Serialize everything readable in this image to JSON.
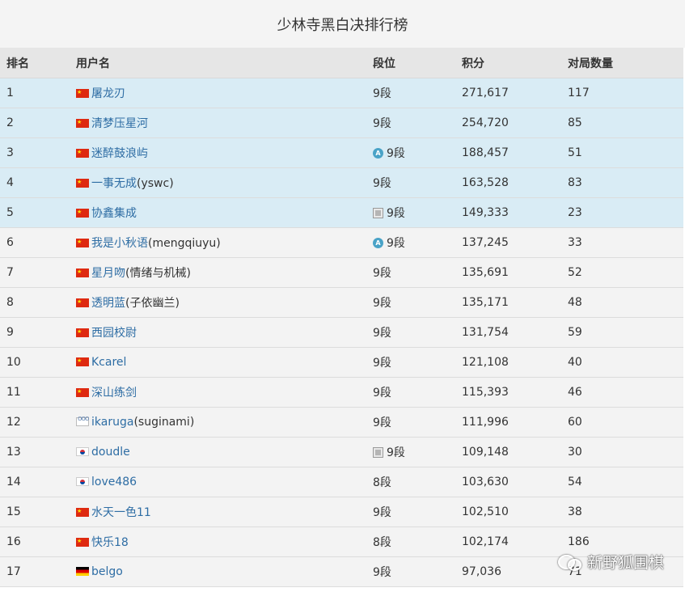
{
  "page_title": "少林寺黑白决排行榜",
  "headers": {
    "rank": "排名",
    "username": "用户名",
    "dan": "段位",
    "score": "积分",
    "games": "对局数量"
  },
  "rows": [
    {
      "rank": "1",
      "flag": "flag-cn",
      "name": "屠龙刃",
      "name_extra": "",
      "dan_icon": "",
      "dan": "9段",
      "score": "271,617",
      "games": "117",
      "highlight": true
    },
    {
      "rank": "2",
      "flag": "flag-cn",
      "name": "清梦压星河",
      "name_extra": "",
      "dan_icon": "",
      "dan": "9段",
      "score": "254,720",
      "games": "85",
      "highlight": true
    },
    {
      "rank": "3",
      "flag": "flag-cn",
      "name": "迷醉鼓浪屿",
      "name_extra": "",
      "dan_icon": "amateur-a-icon",
      "dan": "9段",
      "score": "188,457",
      "games": "51",
      "highlight": true
    },
    {
      "rank": "4",
      "flag": "flag-cn",
      "name": "一事无成",
      "name_extra": "(yswc)",
      "dan_icon": "",
      "dan": "9段",
      "score": "163,528",
      "games": "83",
      "highlight": true
    },
    {
      "rank": "5",
      "flag": "flag-cn",
      "name": "协鑫集成",
      "name_extra": "",
      "dan_icon": "pro-badge-icon",
      "dan": "9段",
      "score": "149,333",
      "games": "23",
      "highlight": true
    },
    {
      "rank": "6",
      "flag": "flag-cn",
      "name": "我是小秋语",
      "name_extra": "(mengqiuyu)",
      "dan_icon": "amateur-a-icon",
      "dan": "9段",
      "score": "137,245",
      "games": "33",
      "highlight": false
    },
    {
      "rank": "7",
      "flag": "flag-cn",
      "name": "星月吻",
      "name_extra": "(情绪与机械)",
      "dan_icon": "",
      "dan": "9段",
      "score": "135,691",
      "games": "52",
      "highlight": false
    },
    {
      "rank": "8",
      "flag": "flag-cn",
      "name": "透明蓝",
      "name_extra": "(子依幽兰)",
      "dan_icon": "",
      "dan": "9段",
      "score": "135,171",
      "games": "48",
      "highlight": false
    },
    {
      "rank": "9",
      "flag": "flag-cn",
      "name": "西园校尉",
      "name_extra": "",
      "dan_icon": "",
      "dan": "9段",
      "score": "131,754",
      "games": "59",
      "highlight": false
    },
    {
      "rank": "10",
      "flag": "flag-cn",
      "name": "Kcarel",
      "name_extra": "",
      "dan_icon": "",
      "dan": "9段",
      "score": "121,108",
      "games": "40",
      "highlight": false
    },
    {
      "rank": "11",
      "flag": "flag-cn",
      "name": "深山练剑",
      "name_extra": "",
      "dan_icon": "",
      "dan": "9段",
      "score": "115,393",
      "games": "46",
      "highlight": false
    },
    {
      "rank": "12",
      "flag": "flag-ol",
      "name": "ikaruga",
      "name_extra": "(suginami)",
      "dan_icon": "",
      "dan": "9段",
      "score": "111,996",
      "games": "60",
      "highlight": false
    },
    {
      "rank": "13",
      "flag": "flag-kr",
      "name": "doudle",
      "name_extra": "",
      "dan_icon": "pro-badge-icon",
      "dan": "9段",
      "score": "109,148",
      "games": "30",
      "highlight": false
    },
    {
      "rank": "14",
      "flag": "flag-kr",
      "name": "love486",
      "name_extra": "",
      "dan_icon": "",
      "dan": "8段",
      "score": "103,630",
      "games": "54",
      "highlight": false
    },
    {
      "rank": "15",
      "flag": "flag-cn",
      "name": "水天一色11",
      "name_extra": "",
      "dan_icon": "",
      "dan": "9段",
      "score": "102,510",
      "games": "38",
      "highlight": false
    },
    {
      "rank": "16",
      "flag": "flag-cn",
      "name": "快乐18",
      "name_extra": "",
      "dan_icon": "",
      "dan": "8段",
      "score": "102,174",
      "games": "186",
      "highlight": false
    },
    {
      "rank": "17",
      "flag": "flag-de",
      "name": "belgo",
      "name_extra": "",
      "dan_icon": "",
      "dan": "9段",
      "score": "97,036",
      "games": "71",
      "highlight": false
    }
  ],
  "watermark": "新野狐围棋",
  "colors": {
    "highlight_row": "#d9ecf5",
    "row": "#f3f3f3",
    "link": "#2e6da4",
    "header_bg": "#e6e6e6"
  }
}
